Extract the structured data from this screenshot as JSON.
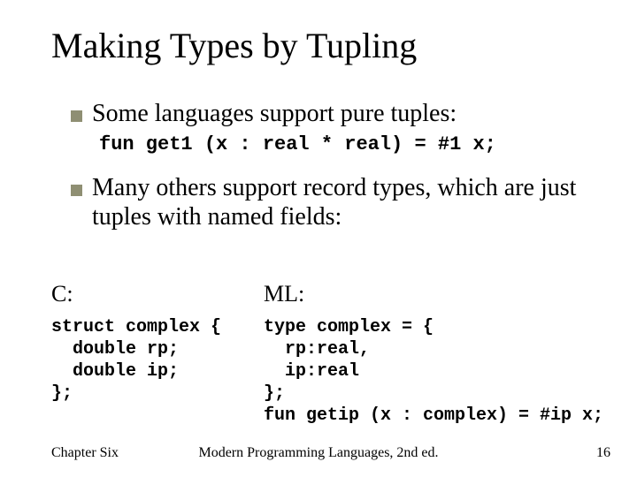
{
  "title": "Making Types by Tupling",
  "bullets": [
    {
      "text": "Some languages support pure tuples:",
      "code": "fun get1 (x : real * real) = #1 x;"
    },
    {
      "text": "Many others support record types, which are just tuples with named fields:"
    }
  ],
  "columns": {
    "left": {
      "label": "C:",
      "code": "struct complex {\n  double rp;\n  double ip;\n};"
    },
    "right": {
      "label": "ML:",
      "code": "type complex = {\n  rp:real,\n  ip:real\n};\nfun getip (x : complex) = #ip x;"
    }
  },
  "footer": {
    "left": "Chapter Six",
    "center": "Modern Programming Languages, 2nd ed.",
    "right": "16"
  }
}
